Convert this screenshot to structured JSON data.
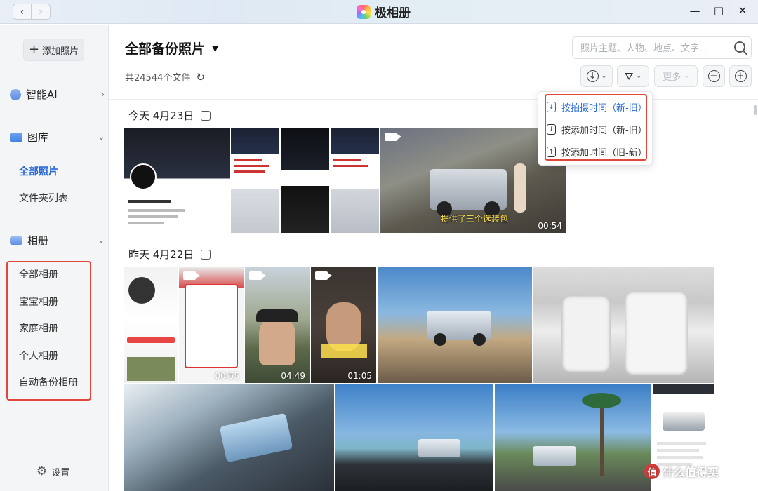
{
  "titlebar": {
    "app_name": "极相册",
    "back_glyph": "‹",
    "forward_glyph": "›",
    "min_glyph": "—",
    "max_glyph": "□",
    "close_glyph": "✕"
  },
  "sidebar": {
    "add_photo_label": "添加照片",
    "groups": [
      {
        "label": "智能AI",
        "chevron": "›",
        "icon": "ai-landscape-icon"
      },
      {
        "label": "图库",
        "chevron": "⌄",
        "icon": "gallery-icon"
      },
      {
        "label": "相册",
        "chevron": "⌄",
        "icon": "album-stack-icon"
      }
    ],
    "gallery_items": [
      "全部照片",
      "文件夹列表"
    ],
    "album_items": [
      "全部相册",
      "宝宝相册",
      "家庭相册",
      "个人相册",
      "自动备份相册"
    ],
    "settings_label": "设置"
  },
  "main": {
    "title": "全部备份照片",
    "file_count": "共24544个文件",
    "search_placeholder": "照片主题、人物、地点、文字...",
    "more_label": "更多",
    "sort_menu": [
      {
        "label": "按拍摄时间（新-旧）",
        "selected": true
      },
      {
        "label": "按添加时间（新-旧）",
        "selected": false
      },
      {
        "label": "按添加时间（旧-新）",
        "selected": false
      }
    ],
    "sections": [
      {
        "date_label": "今天 4月23日"
      },
      {
        "date_label": "昨天 4月22日"
      }
    ],
    "today_thumbs": {
      "video_duration": "00:54",
      "video_caption": "提供了三个选装包"
    },
    "yesterday_durations": [
      "00:55",
      "04:49",
      "01:05"
    ],
    "watermark": "什么值得买",
    "watermark_logo": "值"
  },
  "colors": {
    "accent": "#2a6ad9",
    "highlight_box": "#e0473a",
    "sidebar_bg": "#f4f5f7"
  }
}
